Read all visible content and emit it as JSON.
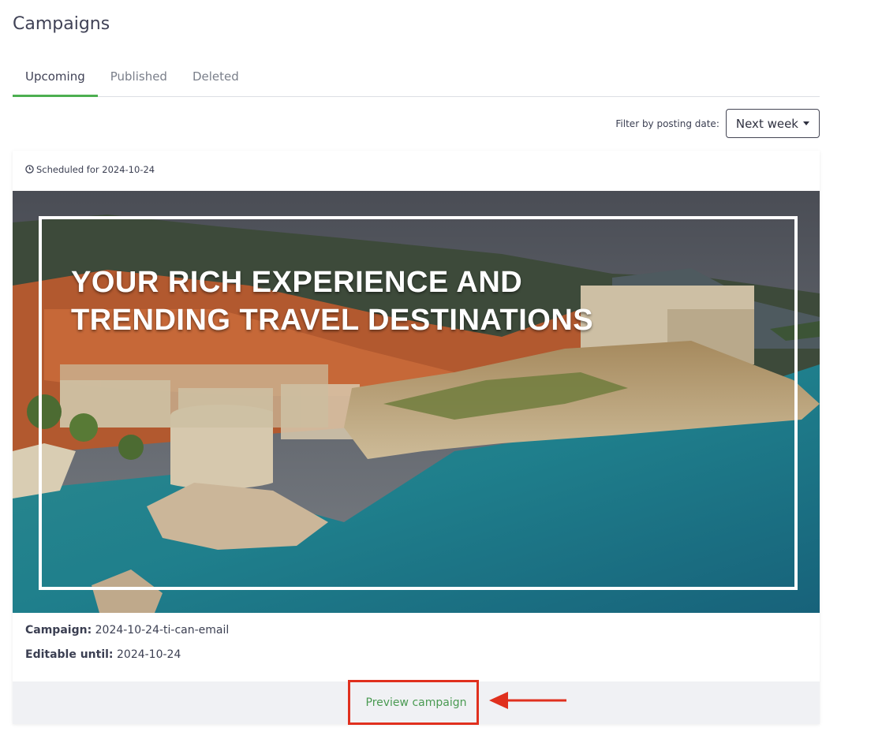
{
  "page": {
    "title": "Campaigns"
  },
  "tabs": [
    {
      "label": "Upcoming",
      "active": true
    },
    {
      "label": "Published",
      "active": false
    },
    {
      "label": "Deleted",
      "active": false
    }
  ],
  "filter": {
    "label": "Filter by posting date:",
    "selected": "Next week"
  },
  "campaign": {
    "scheduled": "Scheduled for 2024-10-24",
    "hero_line1": "YOUR RICH EXPERIENCE AND",
    "hero_line2": "TRENDING TRAVEL DESTINATIONS",
    "campaign_label": "Campaign:",
    "campaign_value": "2024-10-24-ti-can-email",
    "editable_label": "Editable until:",
    "editable_value": "2024-10-24",
    "preview_label": "Preview campaign"
  },
  "icons": {
    "clock": "clock-icon",
    "caret": "caret-down-icon",
    "annotation": "arrow-left-icon"
  },
  "colors": {
    "accent": "#4caf50",
    "link": "#4a9a52",
    "annotation": "#e0301e"
  }
}
